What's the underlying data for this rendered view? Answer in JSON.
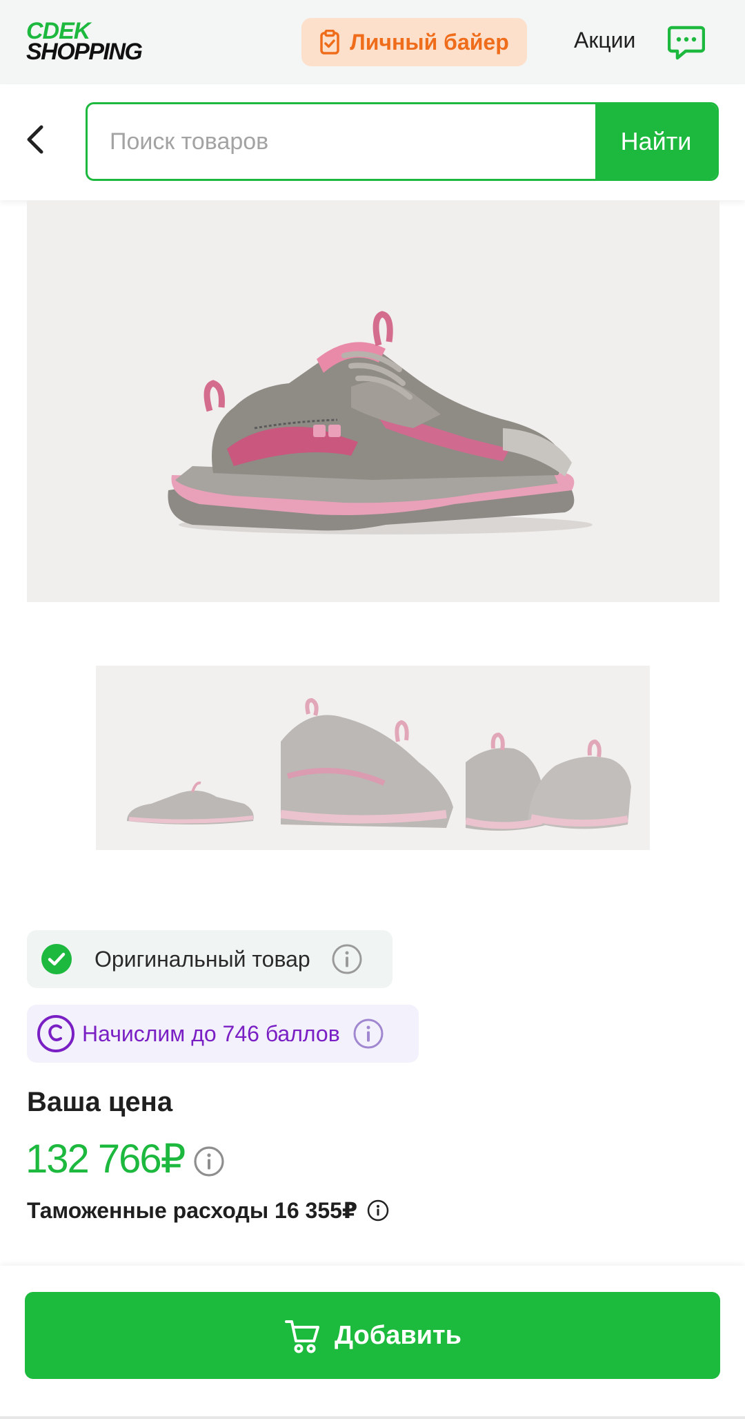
{
  "header": {
    "logo_line1": "CDEK",
    "logo_line2": "SHOPPING",
    "buyer_button_label": "Личный байер",
    "promo_link_label": "Акции",
    "chat_icon": "chat-icon"
  },
  "search": {
    "placeholder": "Поиск товаров",
    "value": "",
    "button_label": "Найти"
  },
  "gallery": {
    "main_image": "sneaker-side-view",
    "thumbnails": [
      "sneaker-angle-view",
      "sneaker-close-up",
      "sneaker-pair-back-view"
    ]
  },
  "badges": {
    "original_label": "Оригинальный товар",
    "points_label": "Начислим до 746 баллов"
  },
  "price": {
    "label": "Ваша цена",
    "value": "132 766₽",
    "customs_label": "Таможенные расходы 16 355₽"
  },
  "actions": {
    "add_label": "Добавить"
  },
  "colors": {
    "brand_green": "#1db83e",
    "buyer_orange": "#ef6c1a",
    "buyer_bg": "#fde0cc",
    "points_purple": "#7a1fc4"
  }
}
